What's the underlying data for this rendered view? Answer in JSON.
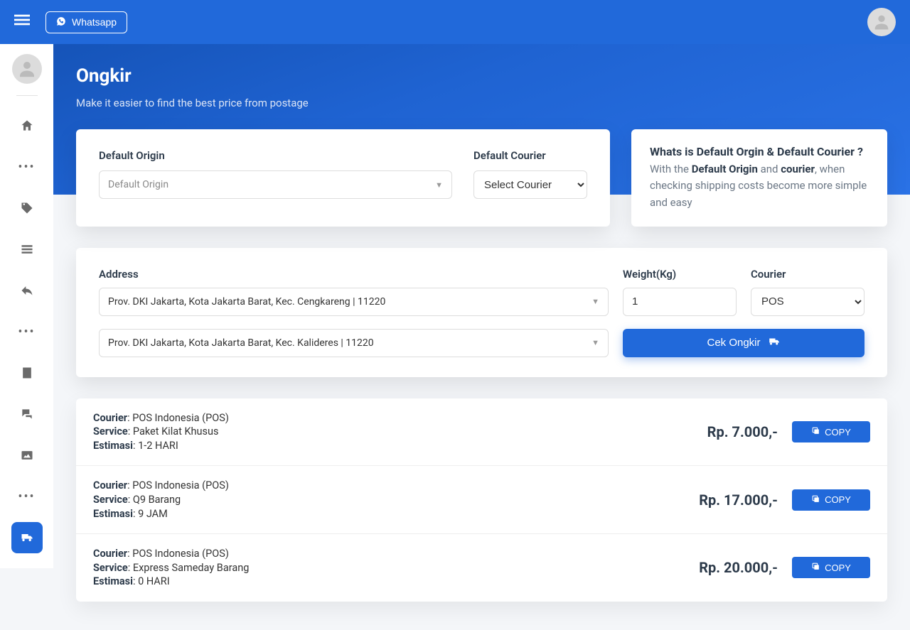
{
  "topbar": {
    "whatsapp_label": "Whatsapp"
  },
  "hero": {
    "title": "Ongkir",
    "subtitle": "Make it easier to find the best price from postage"
  },
  "defaults": {
    "origin_label": "Default Origin",
    "origin_placeholder": "Default Origin",
    "courier_label": "Default Courier",
    "courier_placeholder": "Select Courier"
  },
  "info": {
    "title": "Whats is Default Orgin & Default Courier ?",
    "text_prefix": "With the ",
    "bold1": "Default Origin",
    "mid": " and ",
    "bold2": "courier",
    "text_suffix": ", when checking shipping costs become more simple and easy"
  },
  "address": {
    "label": "Address",
    "from": "Prov. DKI Jakarta, Kota Jakarta Barat, Kec. Cengkareng | 11220",
    "to": "Prov. DKI Jakarta, Kota Jakarta Barat, Kec. Kalideres | 11220",
    "weight_label": "Weight(Kg)",
    "weight_value": "1",
    "courier_label": "Courier",
    "courier_value": "POS",
    "check_button": "Cek Ongkir"
  },
  "labels": {
    "courier": "Courier",
    "service": "Service",
    "estimate": "Estimasi",
    "copy": "COPY"
  },
  "results": [
    {
      "courier": "POS Indonesia (POS)",
      "service": "Paket Kilat Khusus",
      "estimate": "1-2 HARI",
      "price": "Rp. 7.000,-"
    },
    {
      "courier": "POS Indonesia (POS)",
      "service": "Q9 Barang",
      "estimate": "9 JAM",
      "price": "Rp. 17.000,-"
    },
    {
      "courier": "POS Indonesia (POS)",
      "service": "Express Sameday Barang",
      "estimate": "0 HARI",
      "price": "Rp. 20.000,-"
    }
  ]
}
